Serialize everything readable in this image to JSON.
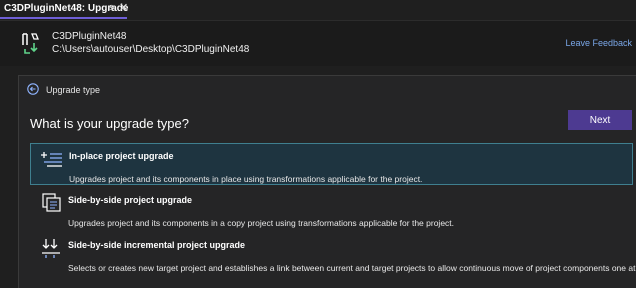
{
  "tab": {
    "title": "C3DPluginNet48: Upgrade",
    "pin_glyph": "⊕",
    "close_glyph": "✕"
  },
  "project": {
    "name": "C3DPluginNet48",
    "path": "C:\\Users\\autouser\\Desktop\\C3DPluginNet48",
    "icon": "project-upgrade-icon"
  },
  "header": {
    "feedback_label": "Leave Feedback"
  },
  "breadcrumb": {
    "icon": "back-arrow-icon",
    "label": "Upgrade type"
  },
  "question": "What is your upgrade type?",
  "next_label": "Next",
  "options": [
    {
      "title": "In-place project upgrade",
      "description": "Upgrades project and its components in place using transformations applicable for the project.",
      "icon": "sparkle-lines-icon",
      "selected": true
    },
    {
      "title": "Side-by-side project upgrade",
      "description": "Upgrades project and its components in a copy project using transformations applicable for the project.",
      "icon": "copy-document-icon",
      "selected": false
    },
    {
      "title": "Side-by-side incremental project upgrade",
      "description": "Selects or creates new target project and establishes a link between current and target projects to allow continuous move of project components one at a time.",
      "icon": "incremental-arrows-icon",
      "selected": false
    }
  ],
  "colors": {
    "accent": "#4d3a91",
    "selected_bg": "#1e3440",
    "selected_border": "#3f7f8f",
    "link": "#7aa7e8"
  }
}
